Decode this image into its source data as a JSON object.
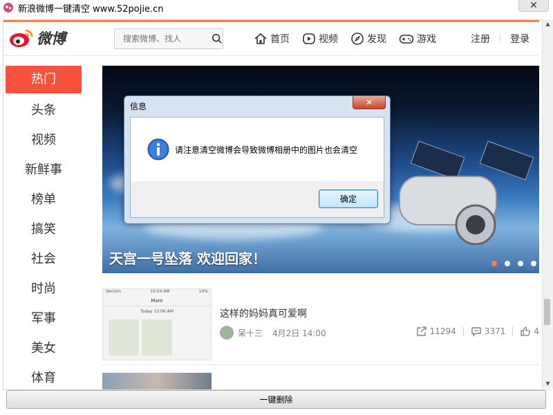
{
  "window": {
    "title": "新浪微博一键清空 www.52pojie.cn",
    "close_label": "✕"
  },
  "header": {
    "logo_text": "微博",
    "search_placeholder": "搜索微博、找人",
    "nav": [
      {
        "label": "首页",
        "icon": "home-icon"
      },
      {
        "label": "视频",
        "icon": "video-icon"
      },
      {
        "label": "发现",
        "icon": "compass-icon"
      },
      {
        "label": "游戏",
        "icon": "gamepad-icon"
      }
    ],
    "register": "注册",
    "login": "登录"
  },
  "sidebar": {
    "items": [
      {
        "label": "热门",
        "active": true
      },
      {
        "label": "头条"
      },
      {
        "label": "视频"
      },
      {
        "label": "新鲜事"
      },
      {
        "label": "榜单"
      },
      {
        "label": "搞笑"
      },
      {
        "label": "社会"
      },
      {
        "label": "时尚"
      },
      {
        "label": "军事"
      },
      {
        "label": "美女"
      },
      {
        "label": "体育"
      }
    ]
  },
  "banner": {
    "caption": "天宫一号坠落 欢迎回家！",
    "dot_count": 4,
    "active_dot": 0
  },
  "feed": {
    "items": [
      {
        "title": "这样的妈妈真可爱啊",
        "author": "呆十三",
        "time": "4月2日 14:00",
        "shares": "11294",
        "comments": "3371",
        "likes": "4",
        "thumb": {
          "carrier": "Verizon",
          "clock": "10:54 AM",
          "battery": "10%",
          "chat_title": "Mom",
          "chat_time": "Today 10:06 AM"
        }
      }
    ]
  },
  "delete_button": "一键删除",
  "dialog": {
    "title": "信息",
    "close_label": "✕",
    "message": "请注意清空微博会导致微博相册中的图片也会清空",
    "ok_label": "确定"
  },
  "colors": {
    "weibo_orange": "#ff8140",
    "hot_red": "#f5533d",
    "dialog_frame": "#d6e3f1"
  }
}
